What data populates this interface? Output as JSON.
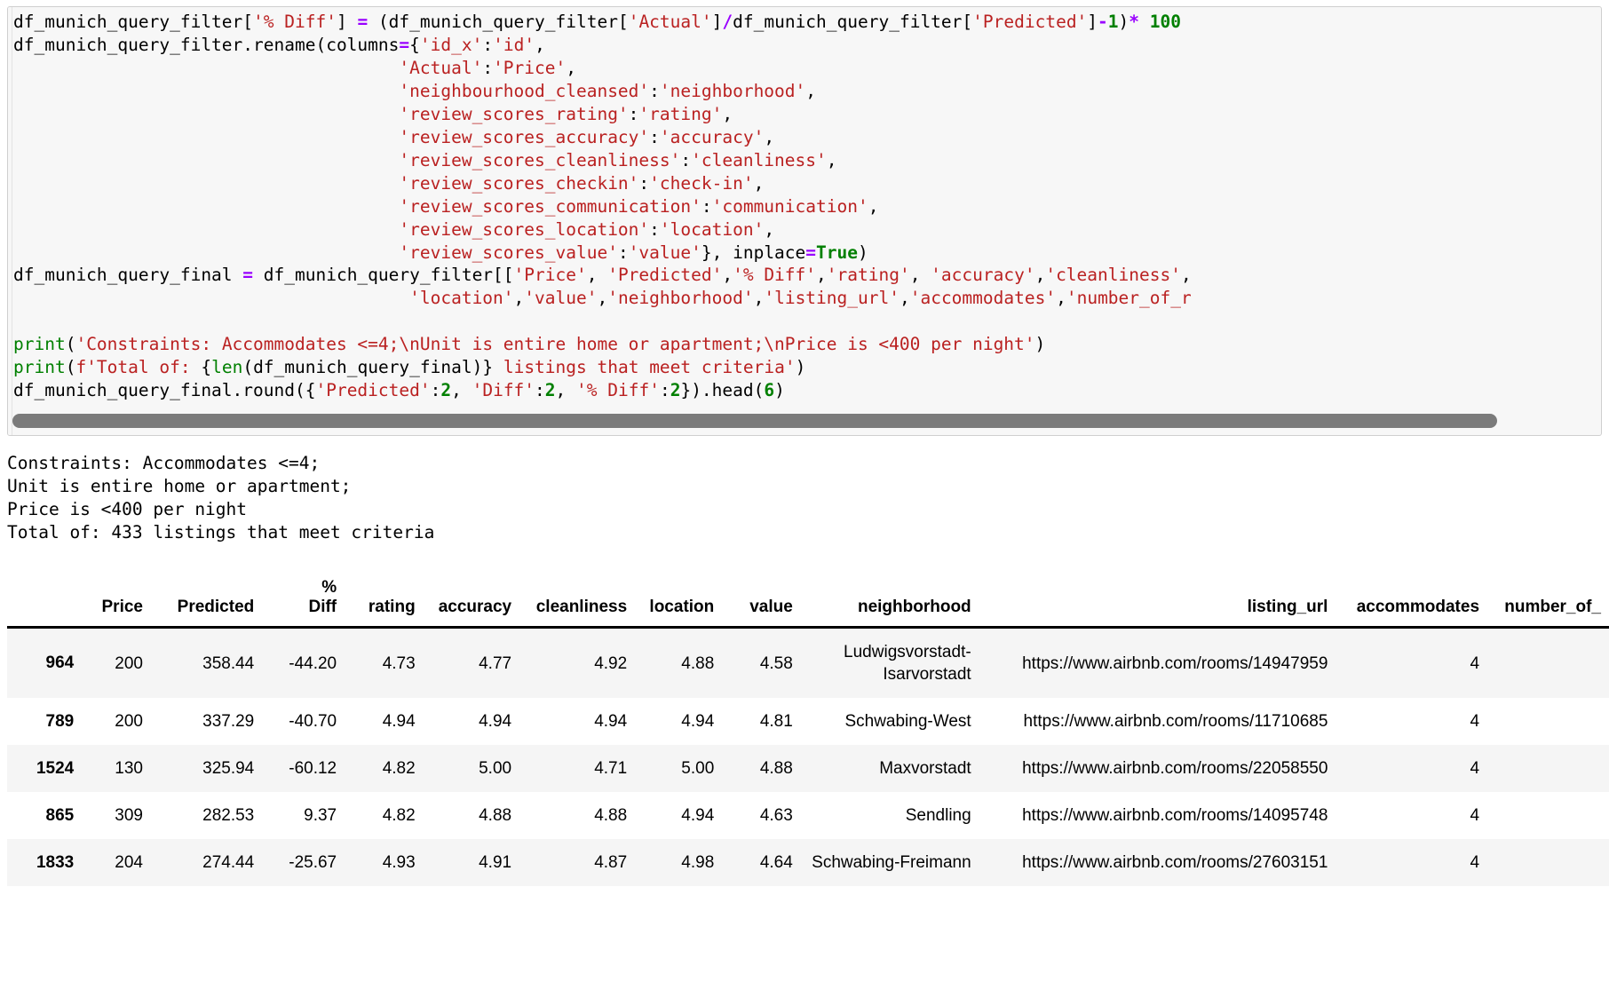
{
  "notebook": {
    "code_lines": [
      [
        {
          "t": "df_munich_query_filter[",
          "c": "plain"
        },
        {
          "t": "'% Diff'",
          "c": "str"
        },
        {
          "t": "]",
          "c": "plain"
        },
        {
          "t": " = ",
          "c": "op"
        },
        {
          "t": "(df_munich_query_filter[",
          "c": "plain"
        },
        {
          "t": "'Actual'",
          "c": "str"
        },
        {
          "t": "]",
          "c": "plain"
        },
        {
          "t": "/",
          "c": "op"
        },
        {
          "t": "df_munich_query_filter[",
          "c": "plain"
        },
        {
          "t": "'Predicted'",
          "c": "str"
        },
        {
          "t": "]",
          "c": "plain"
        },
        {
          "t": "-",
          "c": "op"
        },
        {
          "t": "1",
          "c": "num"
        },
        {
          "t": ")",
          "c": "plain"
        },
        {
          "t": "* ",
          "c": "op"
        },
        {
          "t": "100",
          "c": "num"
        }
      ],
      [
        {
          "t": "df_munich_query_filter.rename(columns",
          "c": "plain"
        },
        {
          "t": "=",
          "c": "op"
        },
        {
          "t": "{",
          "c": "plain"
        },
        {
          "t": "'id_x'",
          "c": "str"
        },
        {
          "t": ":",
          "c": "plain"
        },
        {
          "t": "'id'",
          "c": "str"
        },
        {
          "t": ",",
          "c": "plain"
        }
      ],
      [
        {
          "t": "                                     ",
          "c": "plain"
        },
        {
          "t": "'Actual'",
          "c": "str"
        },
        {
          "t": ":",
          "c": "plain"
        },
        {
          "t": "'Price'",
          "c": "str"
        },
        {
          "t": ",",
          "c": "plain"
        }
      ],
      [
        {
          "t": "                                     ",
          "c": "plain"
        },
        {
          "t": "'neighbourhood_cleansed'",
          "c": "str"
        },
        {
          "t": ":",
          "c": "plain"
        },
        {
          "t": "'neighborhood'",
          "c": "str"
        },
        {
          "t": ",",
          "c": "plain"
        }
      ],
      [
        {
          "t": "                                     ",
          "c": "plain"
        },
        {
          "t": "'review_scores_rating'",
          "c": "str"
        },
        {
          "t": ":",
          "c": "plain"
        },
        {
          "t": "'rating'",
          "c": "str"
        },
        {
          "t": ",",
          "c": "plain"
        }
      ],
      [
        {
          "t": "                                     ",
          "c": "plain"
        },
        {
          "t": "'review_scores_accuracy'",
          "c": "str"
        },
        {
          "t": ":",
          "c": "plain"
        },
        {
          "t": "'accuracy'",
          "c": "str"
        },
        {
          "t": ",",
          "c": "plain"
        }
      ],
      [
        {
          "t": "                                     ",
          "c": "plain"
        },
        {
          "t": "'review_scores_cleanliness'",
          "c": "str"
        },
        {
          "t": ":",
          "c": "plain"
        },
        {
          "t": "'cleanliness'",
          "c": "str"
        },
        {
          "t": ",",
          "c": "plain"
        }
      ],
      [
        {
          "t": "                                     ",
          "c": "plain"
        },
        {
          "t": "'review_scores_checkin'",
          "c": "str"
        },
        {
          "t": ":",
          "c": "plain"
        },
        {
          "t": "'check-in'",
          "c": "str"
        },
        {
          "t": ",",
          "c": "plain"
        }
      ],
      [
        {
          "t": "                                     ",
          "c": "plain"
        },
        {
          "t": "'review_scores_communication'",
          "c": "str"
        },
        {
          "t": ":",
          "c": "plain"
        },
        {
          "t": "'communication'",
          "c": "str"
        },
        {
          "t": ",",
          "c": "plain"
        }
      ],
      [
        {
          "t": "                                     ",
          "c": "plain"
        },
        {
          "t": "'review_scores_location'",
          "c": "str"
        },
        {
          "t": ":",
          "c": "plain"
        },
        {
          "t": "'location'",
          "c": "str"
        },
        {
          "t": ",",
          "c": "plain"
        }
      ],
      [
        {
          "t": "                                     ",
          "c": "plain"
        },
        {
          "t": "'review_scores_value'",
          "c": "str"
        },
        {
          "t": ":",
          "c": "plain"
        },
        {
          "t": "'value'",
          "c": "str"
        },
        {
          "t": "}, inplace",
          "c": "plain"
        },
        {
          "t": "=",
          "c": "op"
        },
        {
          "t": "True",
          "c": "kw"
        },
        {
          "t": ")",
          "c": "plain"
        }
      ],
      [
        {
          "t": "df_munich_query_final ",
          "c": "plain"
        },
        {
          "t": "=",
          "c": "op"
        },
        {
          "t": " df_munich_query_filter[[",
          "c": "plain"
        },
        {
          "t": "'Price'",
          "c": "str"
        },
        {
          "t": ", ",
          "c": "plain"
        },
        {
          "t": "'Predicted'",
          "c": "str"
        },
        {
          "t": ",",
          "c": "plain"
        },
        {
          "t": "'% Diff'",
          "c": "str"
        },
        {
          "t": ",",
          "c": "plain"
        },
        {
          "t": "'rating'",
          "c": "str"
        },
        {
          "t": ", ",
          "c": "plain"
        },
        {
          "t": "'accuracy'",
          "c": "str"
        },
        {
          "t": ",",
          "c": "plain"
        },
        {
          "t": "'cleanliness'",
          "c": "str"
        },
        {
          "t": ",",
          "c": "plain"
        }
      ],
      [
        {
          "t": "                                      ",
          "c": "plain"
        },
        {
          "t": "'location'",
          "c": "str"
        },
        {
          "t": ",",
          "c": "plain"
        },
        {
          "t": "'value'",
          "c": "str"
        },
        {
          "t": ",",
          "c": "plain"
        },
        {
          "t": "'neighborhood'",
          "c": "str"
        },
        {
          "t": ",",
          "c": "plain"
        },
        {
          "t": "'listing_url'",
          "c": "str"
        },
        {
          "t": ",",
          "c": "plain"
        },
        {
          "t": "'accommodates'",
          "c": "str"
        },
        {
          "t": ",",
          "c": "plain"
        },
        {
          "t": "'number_of_r",
          "c": "str"
        }
      ],
      [],
      [
        {
          "t": "print",
          "c": "fn"
        },
        {
          "t": "(",
          "c": "plain"
        },
        {
          "t": "'Constraints: Accommodates <=4;\\nUnit is entire home or apartment;\\nPrice is <400 per night'",
          "c": "str"
        },
        {
          "t": ")",
          "c": "plain"
        }
      ],
      [
        {
          "t": "print",
          "c": "fn"
        },
        {
          "t": "(",
          "c": "plain"
        },
        {
          "t": "f'Total of: ",
          "c": "str"
        },
        {
          "t": "{",
          "c": "plain"
        },
        {
          "t": "len",
          "c": "fn"
        },
        {
          "t": "(df_munich_query_final)}",
          "c": "plain"
        },
        {
          "t": " listings that meet criteria'",
          "c": "str"
        },
        {
          "t": ")",
          "c": "plain"
        }
      ],
      [
        {
          "t": "df_munich_query_final.round({",
          "c": "plain"
        },
        {
          "t": "'Predicted'",
          "c": "str"
        },
        {
          "t": ":",
          "c": "plain"
        },
        {
          "t": "2",
          "c": "num"
        },
        {
          "t": ", ",
          "c": "plain"
        },
        {
          "t": "'Diff'",
          "c": "str"
        },
        {
          "t": ":",
          "c": "plain"
        },
        {
          "t": "2",
          "c": "num"
        },
        {
          "t": ", ",
          "c": "plain"
        },
        {
          "t": "'% Diff'",
          "c": "str"
        },
        {
          "t": ":",
          "c": "plain"
        },
        {
          "t": "2",
          "c": "num"
        },
        {
          "t": "}).head(",
          "c": "plain"
        },
        {
          "t": "6",
          "c": "num"
        },
        {
          "t": ")",
          "c": "plain"
        }
      ]
    ],
    "stdout": "Constraints: Accommodates <=4;\nUnit is entire home or apartment;\nPrice is <400 per night\nTotal of: 433 listings that meet criteria",
    "scrollbar": {
      "name": "code-horizontal-scrollbar",
      "thumb_color": "#7b7b7b"
    }
  },
  "table": {
    "columns": [
      "",
      "Price",
      "Predicted",
      "% Diff",
      "rating",
      "accuracy",
      "cleanliness",
      "location",
      "value",
      "neighborhood",
      "listing_url",
      "accommodates",
      "number_of_"
    ],
    "rows": [
      {
        "index": "964",
        "price": "200",
        "predicted": "358.44",
        "pct_diff": "-44.20",
        "rating": "4.73",
        "accuracy": "4.77",
        "cleanliness": "4.92",
        "location": "4.88",
        "value": "4.58",
        "neighborhood": "Ludwigsvorstadt-Isarvorstadt",
        "listing_url": "https://www.airbnb.com/rooms/14947959",
        "accommodates": "4",
        "number_of": ""
      },
      {
        "index": "789",
        "price": "200",
        "predicted": "337.29",
        "pct_diff": "-40.70",
        "rating": "4.94",
        "accuracy": "4.94",
        "cleanliness": "4.94",
        "location": "4.94",
        "value": "4.81",
        "neighborhood": "Schwabing-West",
        "listing_url": "https://www.airbnb.com/rooms/11710685",
        "accommodates": "4",
        "number_of": ""
      },
      {
        "index": "1524",
        "price": "130",
        "predicted": "325.94",
        "pct_diff": "-60.12",
        "rating": "4.82",
        "accuracy": "5.00",
        "cleanliness": "4.71",
        "location": "5.00",
        "value": "4.88",
        "neighborhood": "Maxvorstadt",
        "listing_url": "https://www.airbnb.com/rooms/22058550",
        "accommodates": "4",
        "number_of": ""
      },
      {
        "index": "865",
        "price": "309",
        "predicted": "282.53",
        "pct_diff": "9.37",
        "rating": "4.82",
        "accuracy": "4.88",
        "cleanliness": "4.88",
        "location": "4.94",
        "value": "4.63",
        "neighborhood": "Sendling",
        "listing_url": "https://www.airbnb.com/rooms/14095748",
        "accommodates": "4",
        "number_of": ""
      },
      {
        "index": "1833",
        "price": "204",
        "predicted": "274.44",
        "pct_diff": "-25.67",
        "rating": "4.93",
        "accuracy": "4.91",
        "cleanliness": "4.87",
        "location": "4.98",
        "value": "4.64",
        "neighborhood": "Schwabing-Freimann",
        "listing_url": "https://www.airbnb.com/rooms/27603151",
        "accommodates": "4",
        "number_of": ""
      }
    ]
  }
}
